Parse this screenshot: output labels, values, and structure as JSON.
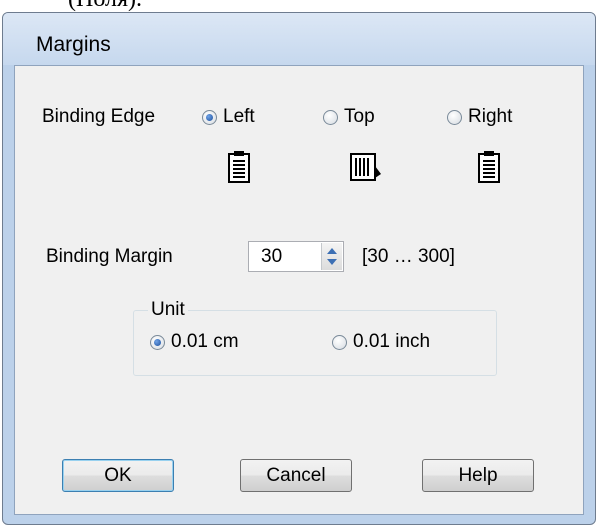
{
  "background_text": "(Поля).",
  "window": {
    "title": "Margins"
  },
  "binding_edge": {
    "label": "Binding Edge",
    "options": [
      {
        "label": "Left",
        "selected": true,
        "icon": "page-binding-left-icon"
      },
      {
        "label": "Top",
        "selected": false,
        "icon": "page-binding-top-icon"
      },
      {
        "label": "Right",
        "selected": false,
        "icon": "page-binding-right-icon"
      }
    ]
  },
  "binding_margin": {
    "label": "Binding Margin",
    "value": "30",
    "range": "[30 … 300]"
  },
  "unit": {
    "legend": "Unit",
    "options": [
      {
        "label": "0.01 cm",
        "selected": true
      },
      {
        "label": "0.01 inch",
        "selected": false
      }
    ]
  },
  "buttons": {
    "ok": "OK",
    "cancel": "Cancel",
    "help": "Help"
  }
}
